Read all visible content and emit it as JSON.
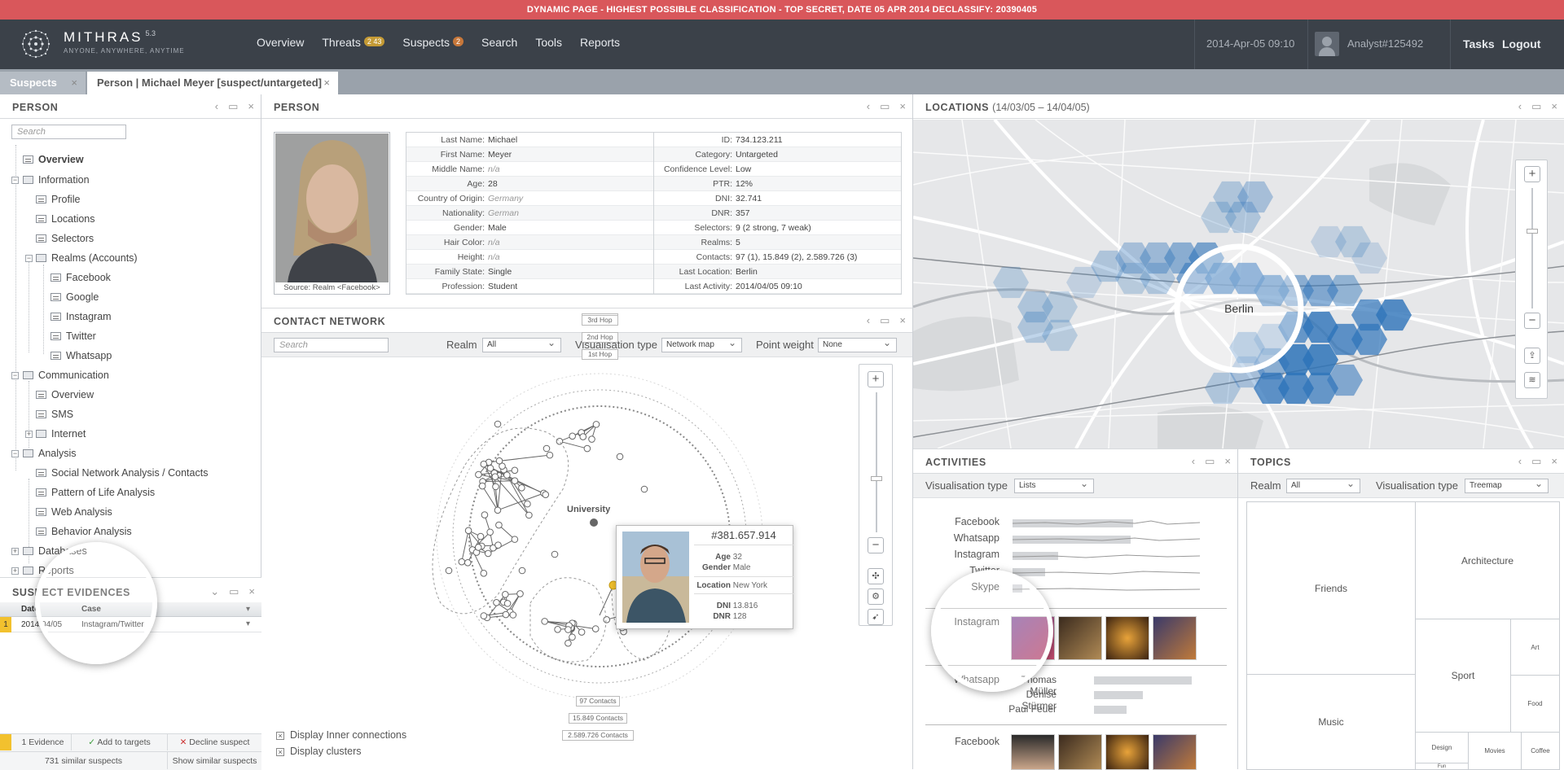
{
  "banner": {
    "text": "DYNAMIC PAGE - HIGHEST POSSIBLE CLASSIFICATION - TOP SECRET, DATE 05 APR 2014 DECLASSIFY: 20390405"
  },
  "app": {
    "name": "MITHRAS",
    "version": "5.3",
    "tagline": "ANYONE, ANYWHERE, ANYTIME"
  },
  "nav": {
    "overview": "Overview",
    "threats": "Threats",
    "threats_badge_a": "2",
    "threats_badge_b": "43",
    "suspects": "Suspects",
    "suspects_badge": "2",
    "search": "Search",
    "tools": "Tools",
    "reports": "Reports"
  },
  "header": {
    "datetime": "2014-Apr-05 09:10",
    "analyst": "Analyst#125492",
    "tasks": "Tasks",
    "logout": "Logout"
  },
  "tabs": [
    {
      "label": "Suspects"
    },
    {
      "label": "Person | Michael Meyer [suspect/untargeted]"
    }
  ],
  "sidebar": {
    "title": "PERSON",
    "search_placeholder": "Search",
    "items": {
      "overview": "Overview",
      "information": "Information",
      "profile": "Profile",
      "locations": "Locations",
      "selectors": "Selectors",
      "realms": "Realms (Accounts)",
      "facebook": "Facebook",
      "google": "Google",
      "instagram": "Instagram",
      "twitter": "Twitter",
      "whatsapp": "Whatsapp",
      "communication": "Communication",
      "comm_overview": "Overview",
      "sms": "SMS",
      "internet": "Internet",
      "analysis": "Analysis",
      "sna": "Social Network Analysis / Contacts",
      "pol": "Pattern of Life Analysis",
      "web": "Web Analysis",
      "behavior": "Behavior Analysis",
      "databases": "Databases",
      "reports": "Reports"
    }
  },
  "evidences": {
    "title": "SUSPECT EVIDENCES",
    "col_date": "Date",
    "col_case": "Case",
    "row_num": "1",
    "row_date": "2014/04/05",
    "row_case": "Instagram/Twitter",
    "count_label": "1 Evidence",
    "add_label": "Add to targets",
    "decline_label": "Decline suspect",
    "similar": "731 similar suspects",
    "show_similar": "Show similar suspects"
  },
  "person": {
    "title": "PERSON",
    "photo_caption": "Source: Realm <Facebook>",
    "left": [
      {
        "k": "Last Name:",
        "v": "Michael"
      },
      {
        "k": "First Name:",
        "v": "Meyer"
      },
      {
        "k": "Middle Name:",
        "v": "n/a"
      },
      {
        "k": "Age:",
        "v": "28"
      },
      {
        "k": "Country of Origin:",
        "v": "Germany"
      },
      {
        "k": "Nationality:",
        "v": "German"
      },
      {
        "k": "Gender:",
        "v": "Male"
      },
      {
        "k": "Hair Color:",
        "v": "n/a"
      },
      {
        "k": "Height:",
        "v": "n/a"
      },
      {
        "k": "Family State:",
        "v": "Single"
      },
      {
        "k": "Profession:",
        "v": "Student"
      }
    ],
    "right": [
      {
        "k": "ID:",
        "v": "734.123.211"
      },
      {
        "k": "Category:",
        "v": "Untargeted"
      },
      {
        "k": "Confidence Level:",
        "v": "Low"
      },
      {
        "k": "PTR:",
        "v": "12%"
      },
      {
        "k": "DNI:",
        "v": "32.741"
      },
      {
        "k": "DNR:",
        "v": "357"
      },
      {
        "k": "Selectors:",
        "v": "9 (2 strong, 7 weak)"
      },
      {
        "k": "Realms:",
        "v": "5"
      },
      {
        "k": "Contacts:",
        "v": "97 (1), 15.849 (2), 2.589.726 (3)"
      },
      {
        "k": "Last Location:",
        "v": "Berlin"
      },
      {
        "k": "Last Activity:",
        "v": "2014/04/05 09:10"
      }
    ]
  },
  "network": {
    "title": "CONTACT NETWORK",
    "search_placeholder": "Search",
    "realm_label": "Realm",
    "realm_value": "All",
    "vis_label": "Visualisation type",
    "vis_value": "Network map",
    "weight_label": "Point weight",
    "weight_value": "None",
    "hops": [
      "3rd Hop",
      "2nd Hop",
      "1st Hop"
    ],
    "contacts": [
      "97 Contacts",
      "15.849 Contacts",
      "2.589.726 Contacts"
    ],
    "cluster_label": "University",
    "popup": {
      "id": "#381.657.914",
      "age_k": "Age",
      "age_v": "32",
      "gender_k": "Gender",
      "gender_v": "Male",
      "loc_k": "Location",
      "loc_v": "New York",
      "dni_k": "DNI",
      "dni_v": "13.816",
      "dnr_k": "DNR",
      "dnr_v": "128"
    },
    "opt_inner": "Display Inner connections",
    "opt_clusters": "Display clusters"
  },
  "locations": {
    "title": "LOCATIONS",
    "range": "(14/03/05 – 14/04/05)",
    "city": "Berlin"
  },
  "activities": {
    "title": "ACTIVITIES",
    "vis_label": "Visualisation type",
    "vis_value": "Lists",
    "rows": [
      "Facebook",
      "Whatsapp",
      "Instagram",
      "Twitter",
      "Skype"
    ],
    "instagram_label": "Instagram",
    "whatsapp_label": "Whatsapp",
    "facebook_label": "Facebook",
    "contacts": [
      "Thomas Müller",
      "Denise Stürmer",
      "Paul Feuer"
    ]
  },
  "topics": {
    "title": "TOPICS",
    "realm_label": "Realm",
    "realm_value": "All",
    "vis_label": "Visualisation type",
    "vis_value": "Treemap",
    "cells": {
      "friends": "Friends",
      "architecture": "Architecture",
      "sport": "Sport",
      "art": "Art",
      "food": "Food",
      "music": "Music",
      "design": "Design",
      "movies": "Movies",
      "coffee": "Coffee",
      "fun": "Fun"
    }
  },
  "colors": {
    "banner": "#d9575b",
    "nav_bg": "#3b4149",
    "accent_blue": "#3a7fc0",
    "highlight_yellow": "#f2c12e"
  }
}
